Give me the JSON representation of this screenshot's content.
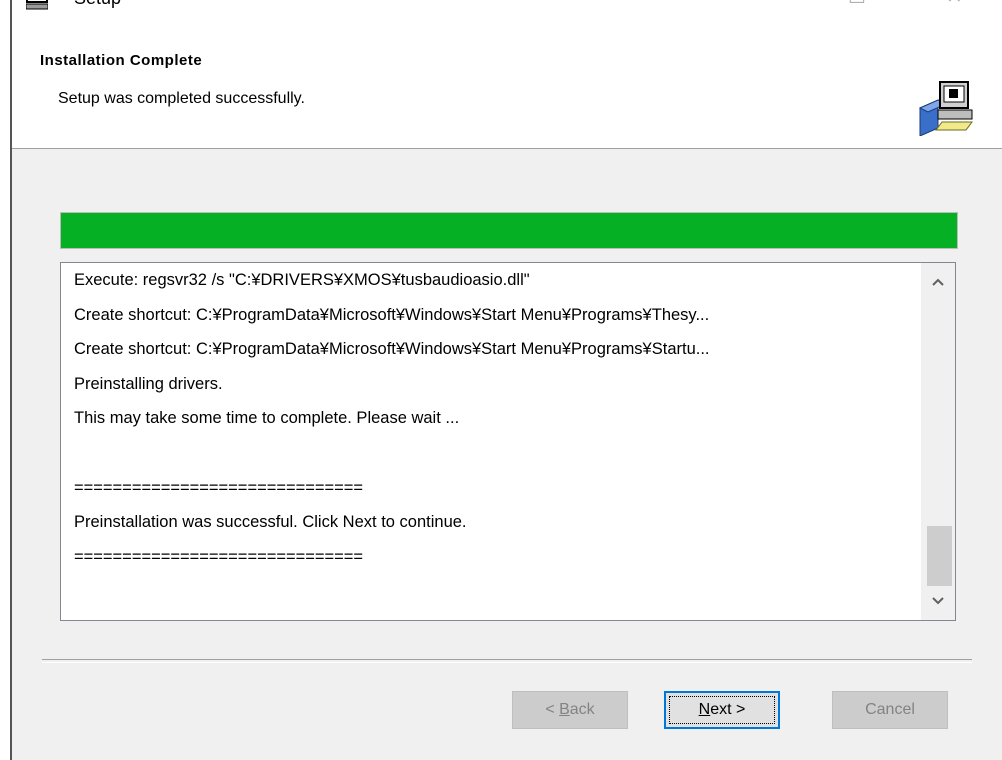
{
  "window": {
    "title": "Setup"
  },
  "header": {
    "title": "Installation Complete",
    "subtitle": "Setup was completed successfully."
  },
  "progress": {
    "percent": 100,
    "color": "#06b025"
  },
  "log": {
    "lines": [
      "Execute: regsvr32 /s \"C:¥DRIVERS¥XMOS¥tusbaudioasio.dll\"",
      "Create shortcut: C:¥ProgramData¥Microsoft¥Windows¥Start Menu¥Programs¥Thesy...",
      "Create shortcut: C:¥ProgramData¥Microsoft¥Windows¥Start Menu¥Programs¥Startu...",
      "Preinstalling drivers.",
      "This may take some time to complete. Please wait ...",
      "",
      "==============================",
      "Preinstallation was successful. Click Next to continue.",
      "=============================="
    ]
  },
  "buttons": {
    "back_prefix": "< ",
    "back_key": "B",
    "back_rest": "ack",
    "next_key": "N",
    "next_rest": "ext >",
    "cancel": "Cancel"
  },
  "icons": {
    "app": "setup-computer-icon",
    "header": "installer-computer-icon",
    "scroll_up": "chevron-up-icon",
    "scroll_down": "chevron-down-icon"
  }
}
